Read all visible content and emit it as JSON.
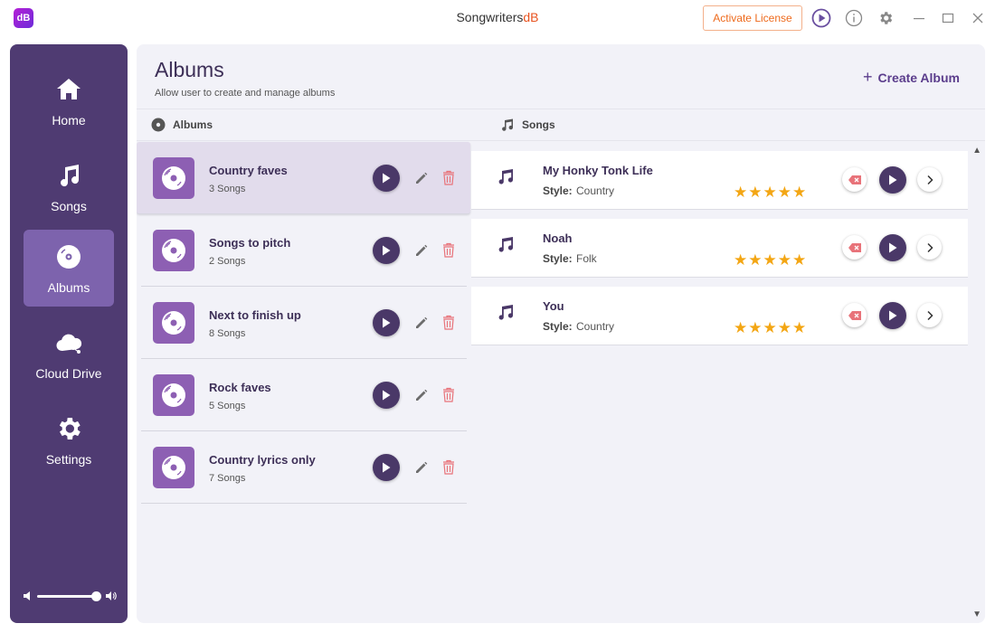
{
  "window": {
    "logo_text": "dB",
    "title_main": "Songwriters",
    "title_accent": "dB",
    "activate_label": "Activate License",
    "icons": [
      "play-circle-icon",
      "info-icon",
      "gear-icon",
      "minimize-icon",
      "maximize-icon",
      "close-icon"
    ]
  },
  "sidebar": {
    "items": [
      {
        "label": "Home",
        "icon": "home-icon"
      },
      {
        "label": "Songs",
        "icon": "music-note-icon"
      },
      {
        "label": "Albums",
        "icon": "disc-icon",
        "active": true
      },
      {
        "label": "Cloud Drive",
        "icon": "cloud-share-icon"
      },
      {
        "label": "Settings",
        "icon": "gear-icon"
      }
    ],
    "volume_level": 0.9
  },
  "header": {
    "title": "Albums",
    "subtitle": "Allow user to create and manage albums",
    "create_label": "Create Album"
  },
  "columns": {
    "albums": "Albums",
    "songs": "Songs"
  },
  "albums": [
    {
      "name": "Country faves",
      "count": "3 Songs",
      "selected": true
    },
    {
      "name": "Songs to pitch",
      "count": "2 Songs"
    },
    {
      "name": "Next to finish up",
      "count": "8 Songs"
    },
    {
      "name": "Rock faves",
      "count": "5 Songs"
    },
    {
      "name": "Country lyrics only",
      "count": "7 Songs"
    }
  ],
  "songs": [
    {
      "title": "My Honky Tonk Life",
      "style_label": "Style:",
      "style": "Country",
      "rating": 5,
      "stars": "★★★★★"
    },
    {
      "title": "Noah",
      "style_label": "Style:",
      "style": "Folk",
      "rating": 5,
      "stars": "★★★★★"
    },
    {
      "title": "You",
      "style_label": "Style:",
      "style": "Country",
      "rating": 5,
      "stars": "★★★★★"
    }
  ],
  "colors": {
    "sidebar": "#4f3b72",
    "sidebar_active": "#7d63ad",
    "accent_orange": "#ee6a1c",
    "star": "#f3a614",
    "delete_red": "#e8737a"
  }
}
